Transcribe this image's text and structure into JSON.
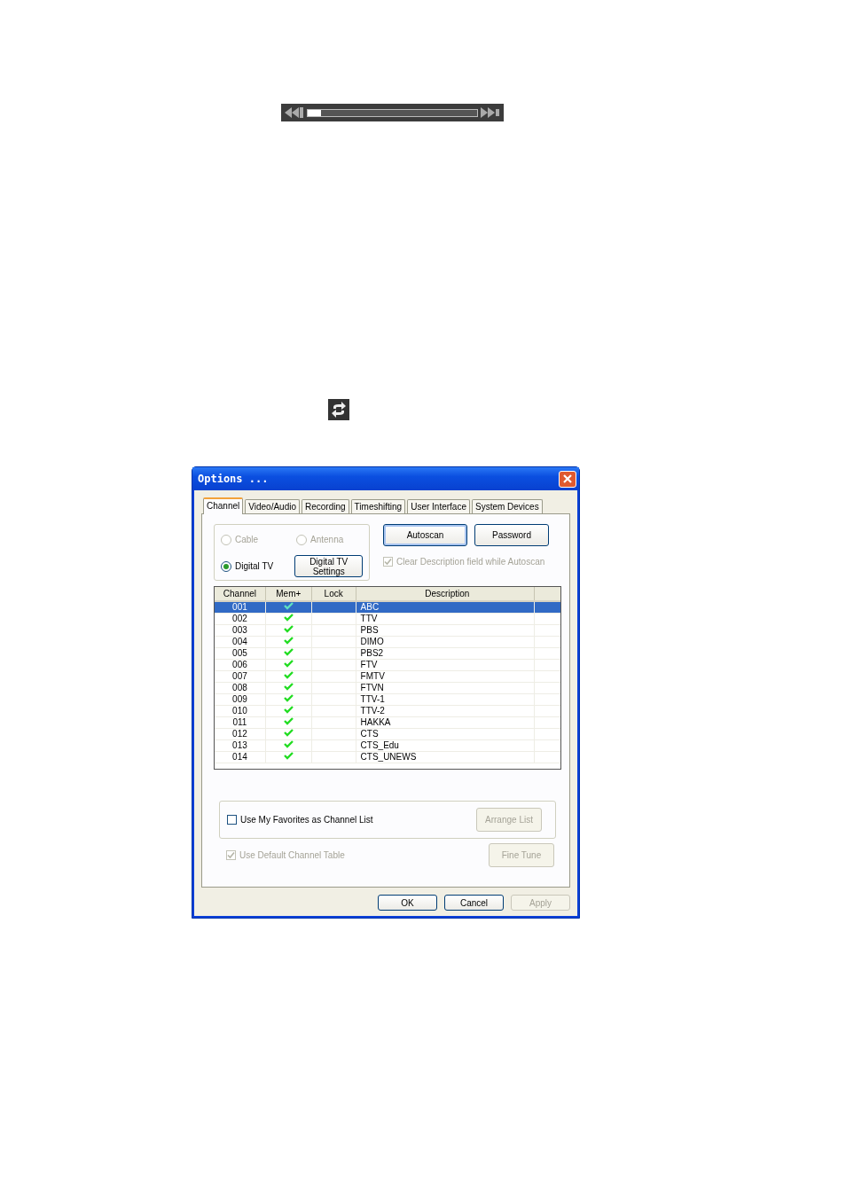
{
  "seek_bar": {
    "level": 0.08
  },
  "dialog": {
    "title": "Options ...",
    "tabs": [
      {
        "label": "Channel",
        "selected": true
      },
      {
        "label": "Video/Audio",
        "selected": false
      },
      {
        "label": "Recording",
        "selected": false
      },
      {
        "label": "Timeshifting",
        "selected": false
      },
      {
        "label": "User Interface",
        "selected": false
      },
      {
        "label": "System Devices",
        "selected": false
      }
    ],
    "source_radios": [
      {
        "label": "Cable",
        "selected": false,
        "disabled": true
      },
      {
        "label": "Antenna",
        "selected": false,
        "disabled": true
      },
      {
        "label": "Digital TV",
        "selected": true,
        "disabled": false
      }
    ],
    "digital_tv_settings_button": "Digital TV Settings",
    "autoscan_button": "Autoscan",
    "password_button": "Password",
    "clear_description": {
      "label": "Clear Description field while Autoscan",
      "checked": true,
      "disabled": true
    },
    "table": {
      "columns": [
        "Channel",
        "Mem+",
        "Lock",
        "Description"
      ],
      "rows": [
        {
          "channel": "001",
          "mem_plus": true,
          "description": "ABC",
          "selected": true
        },
        {
          "channel": "002",
          "mem_plus": true,
          "description": "TTV",
          "selected": false
        },
        {
          "channel": "003",
          "mem_plus": true,
          "description": "PBS",
          "selected": false
        },
        {
          "channel": "004",
          "mem_plus": true,
          "description": "DIMO",
          "selected": false
        },
        {
          "channel": "005",
          "mem_plus": true,
          "description": "PBS2",
          "selected": false
        },
        {
          "channel": "006",
          "mem_plus": true,
          "description": "FTV",
          "selected": false
        },
        {
          "channel": "007",
          "mem_plus": true,
          "description": "FMTV",
          "selected": false
        },
        {
          "channel": "008",
          "mem_plus": true,
          "description": "FTVN",
          "selected": false
        },
        {
          "channel": "009",
          "mem_plus": true,
          "description": "TTV-1",
          "selected": false
        },
        {
          "channel": "010",
          "mem_plus": true,
          "description": "TTV-2",
          "selected": false
        },
        {
          "channel": "011",
          "mem_plus": true,
          "description": "HAKKA",
          "selected": false
        },
        {
          "channel": "012",
          "mem_plus": true,
          "description": "CTS",
          "selected": false
        },
        {
          "channel": "013",
          "mem_plus": true,
          "description": "CTS_Edu",
          "selected": false
        },
        {
          "channel": "014",
          "mem_plus": true,
          "description": "CTS_UNEWS",
          "selected": false
        }
      ]
    },
    "favorites": {
      "label": "Use My Favorites as Channel List",
      "checked": false,
      "disabled": false
    },
    "arrange_list_button": {
      "label": "Arrange List",
      "disabled": true
    },
    "default_table": {
      "label": "Use Default Channel Table",
      "checked": true,
      "disabled": true
    },
    "fine_tune_button": {
      "label": "Fine Tune",
      "disabled": true
    },
    "footer_buttons": [
      {
        "label": "OK",
        "disabled": false
      },
      {
        "label": "Cancel",
        "disabled": false
      },
      {
        "label": "Apply",
        "disabled": true
      }
    ]
  }
}
